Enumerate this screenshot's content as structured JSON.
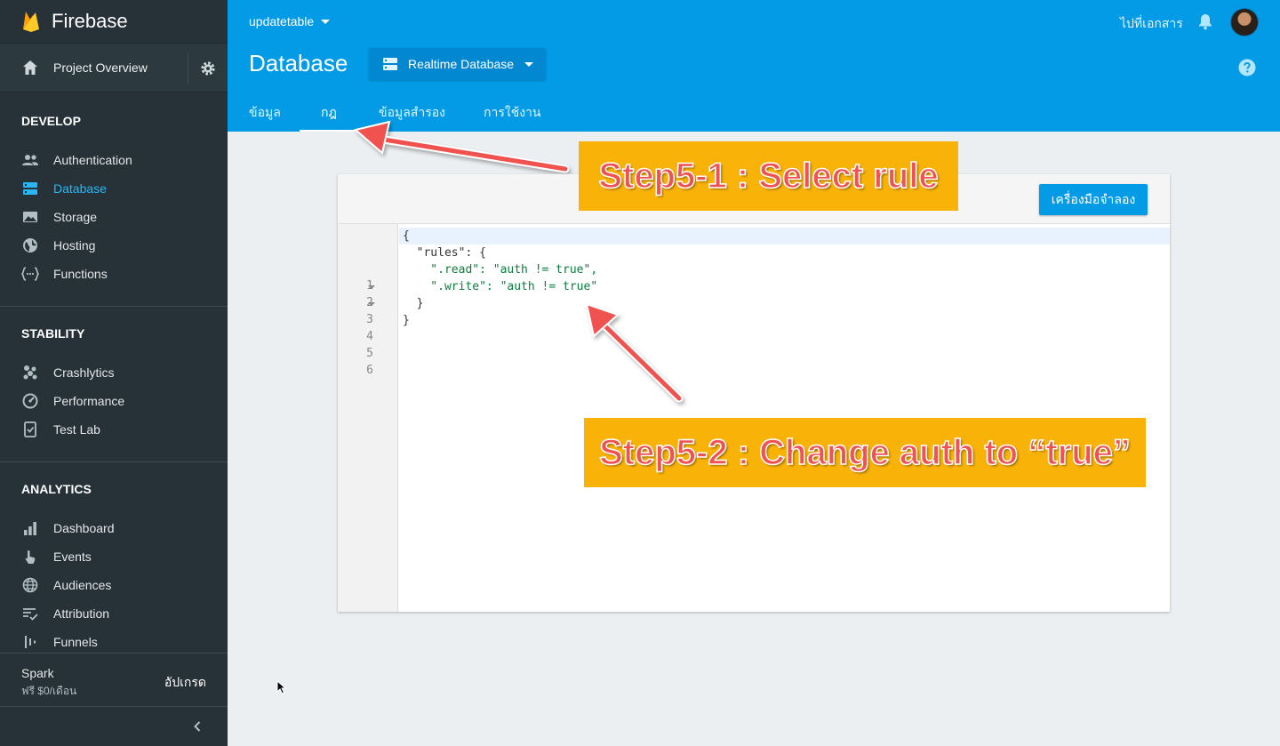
{
  "sidebar": {
    "brand": "Firebase",
    "project_overview": "Project Overview",
    "sections": {
      "develop": {
        "title": "DEVELOP",
        "items": [
          {
            "label": "Authentication",
            "icon": "people-icon"
          },
          {
            "label": "Database",
            "icon": "database-icon",
            "active": true
          },
          {
            "label": "Storage",
            "icon": "image-icon"
          },
          {
            "label": "Hosting",
            "icon": "globe-icon"
          },
          {
            "label": "Functions",
            "icon": "functions-icon"
          }
        ]
      },
      "stability": {
        "title": "STABILITY",
        "items": [
          {
            "label": "Crashlytics",
            "icon": "crashlytics-icon"
          },
          {
            "label": "Performance",
            "icon": "speedometer-icon"
          },
          {
            "label": "Test Lab",
            "icon": "test-lab-icon"
          }
        ]
      },
      "analytics": {
        "title": "ANALYTICS",
        "items": [
          {
            "label": "Dashboard",
            "icon": "bar-chart-icon"
          },
          {
            "label": "Events",
            "icon": "touch-icon"
          },
          {
            "label": "Audiences",
            "icon": "globe-icon"
          },
          {
            "label": "Attribution",
            "icon": "attribution-icon"
          },
          {
            "label": "Funnels",
            "icon": "funnels-icon"
          }
        ]
      }
    },
    "plan": {
      "name": "Spark",
      "price": "ฟรี $0/เดือน",
      "upgrade": "อัปเกรด"
    }
  },
  "header": {
    "project": "updatetable",
    "docs_link": "ไปที่เอกสาร",
    "title": "Database",
    "db_selector": "Realtime Database",
    "tabs": [
      {
        "label": "ข้อมูล"
      },
      {
        "label": "กฎ",
        "active": true
      },
      {
        "label": "ข้อมูลสำรอง"
      },
      {
        "label": "การใช้งาน"
      }
    ]
  },
  "rules_editor": {
    "simulator_button": "เครื่องมือจำลอง",
    "line_numbers": [
      "1",
      "2",
      "3",
      "4",
      "5",
      "6"
    ],
    "lines": [
      "{",
      "  \"rules\": {",
      "    \".read\": \"auth != true\",",
      "    \".write\": \"auth != true\"",
      "  }",
      "}"
    ]
  },
  "annotations": {
    "step1": "Step5-1 : Select rule",
    "step2": "Step5-2 : Change auth to “true”",
    "arrow_color": "#f0524f",
    "callout_color": "#f9b208"
  },
  "colors": {
    "header_blue": "#039be5",
    "sidebar_dark": "#263238",
    "active_blue": "#29b6f6"
  }
}
